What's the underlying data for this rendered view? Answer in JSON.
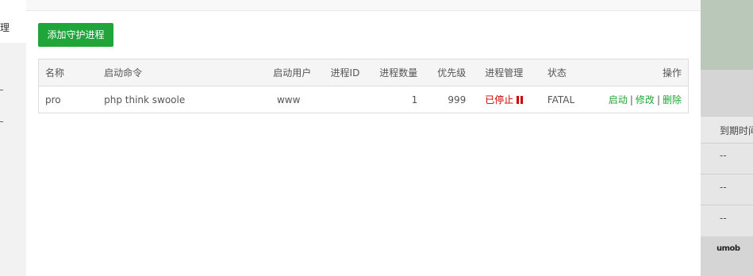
{
  "sidebar": {
    "visible_text": "理"
  },
  "toolbar": {
    "add_button_label": "添加守护进程"
  },
  "table": {
    "headers": [
      "名称",
      "启动命令",
      "启动用户",
      "进程ID",
      "进程数量",
      "优先级",
      "进程管理",
      "状态",
      "操作"
    ],
    "rows": [
      {
        "name": "pro",
        "command": "php think swoole",
        "user": "www",
        "pid": "",
        "count": "1",
        "priority": "999",
        "manage": "已停止",
        "state": "FATAL",
        "ops": [
          "启动",
          "修改",
          "删除"
        ]
      }
    ]
  },
  "background_page": {
    "column_header": "到期时间",
    "cells": [
      "--",
      "--",
      "--"
    ],
    "logo_text": "umob"
  },
  "colors": {
    "accent": "#20a53a",
    "stopped": "#cc0000"
  }
}
